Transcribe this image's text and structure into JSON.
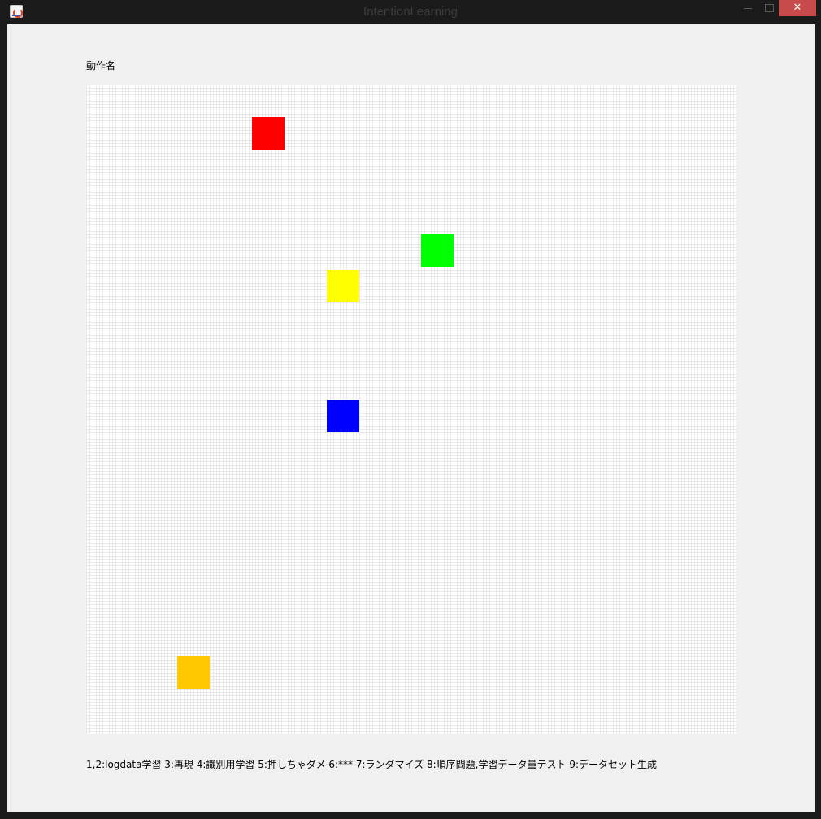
{
  "window": {
    "title": "IntentionLearning",
    "close_glyph": "✕",
    "icon": "java-coffee-icon"
  },
  "main": {
    "action_label": "動作名",
    "help_text": "1,2:logdata学習 3:再現 4:識別用学習 5:押しちゃダメ 6:*** 7:ランダマイズ 8:順序問題,学習データ量テスト 9:データセット生成"
  },
  "blocks": [
    {
      "name": "red-block",
      "color": "#ff0000"
    },
    {
      "name": "green-block",
      "color": "#00ff00"
    },
    {
      "name": "yellow-block",
      "color": "#ffff00"
    },
    {
      "name": "blue-block",
      "color": "#0000ff"
    },
    {
      "name": "orange-block",
      "color": "#ffc800"
    }
  ]
}
